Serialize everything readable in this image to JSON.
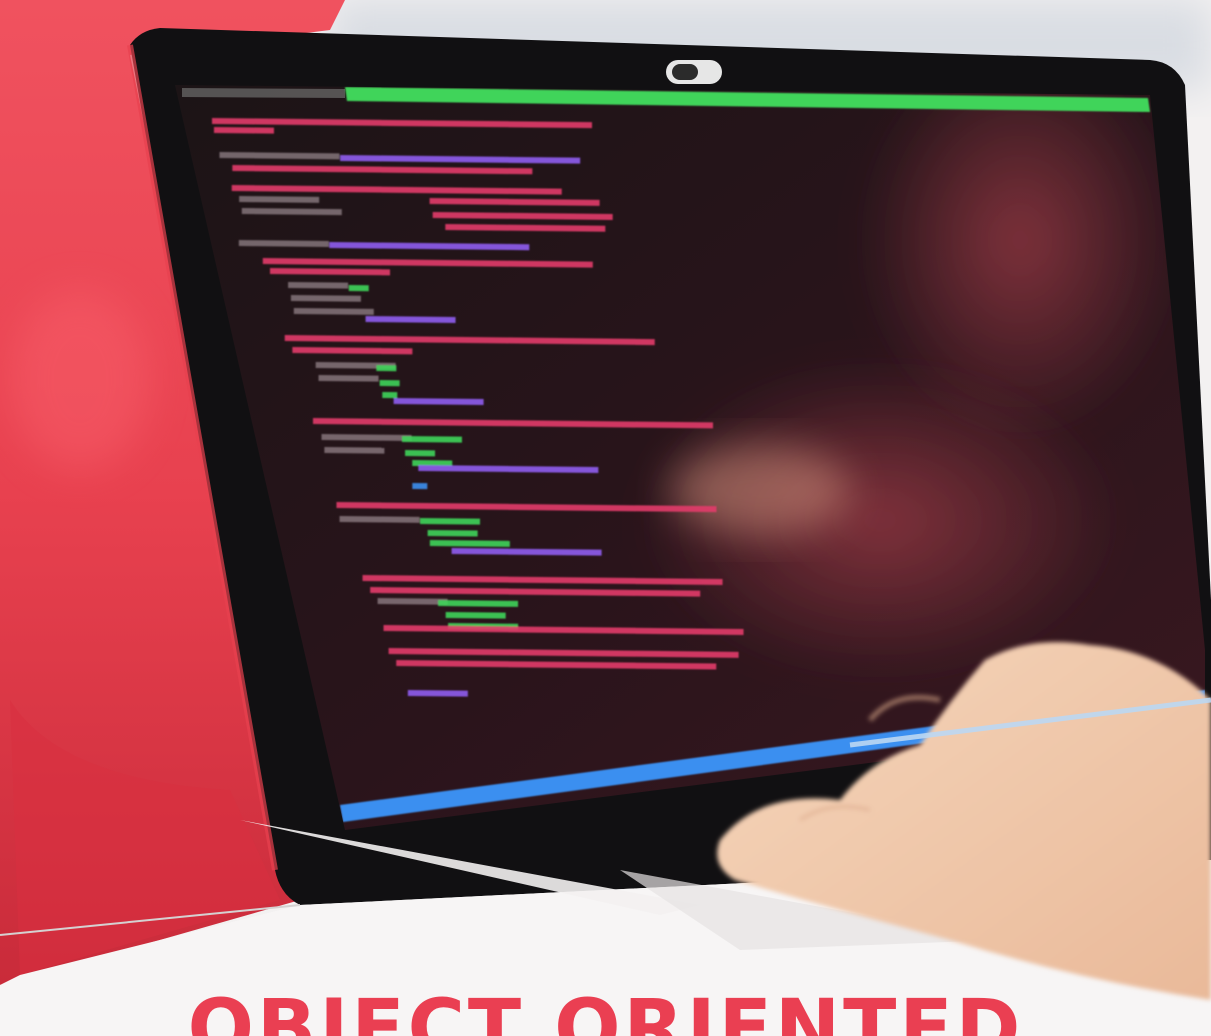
{
  "cover": {
    "title": "OBJECT ORIENTED"
  },
  "colors": {
    "background": "#f3f1f1",
    "accent_red": "#e8414f",
    "accent_dark_red": "#b8212e",
    "title_red": "#ea3f52",
    "screen": "#1e1418",
    "bezel": "#111012",
    "code_green": "#3fd45a",
    "code_purple": "#8f5cf0",
    "code_pink": "#e23b6a",
    "code_blue": "#3b8ff0",
    "skin": "#f0c9a8"
  },
  "icons": {
    "webcam": "webcam-icon"
  }
}
